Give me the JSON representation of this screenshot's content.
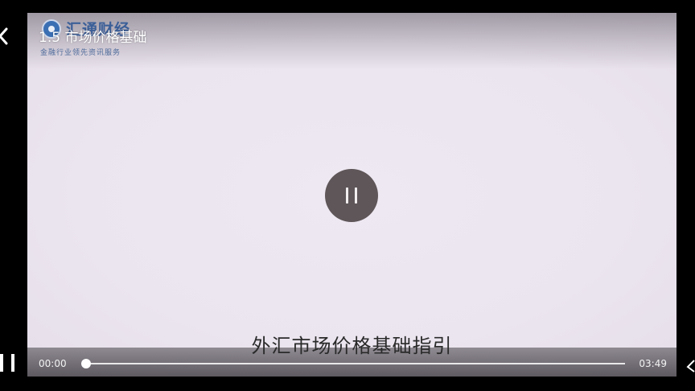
{
  "video": {
    "title": "1.5 市场价格基础",
    "subtitle": "外汇市场价格基础指引"
  },
  "logo": {
    "name": "汇通财经",
    "tagline": "金融行业领先资讯服务"
  },
  "controls": {
    "current_time": "00:00",
    "duration": "03:49",
    "progress": 0.0,
    "state_icon": "pause-icon"
  },
  "colors": {
    "video_background": "#ebe5ef",
    "pause_button": "#5e5658",
    "logo_blue": "#3b5f98"
  }
}
